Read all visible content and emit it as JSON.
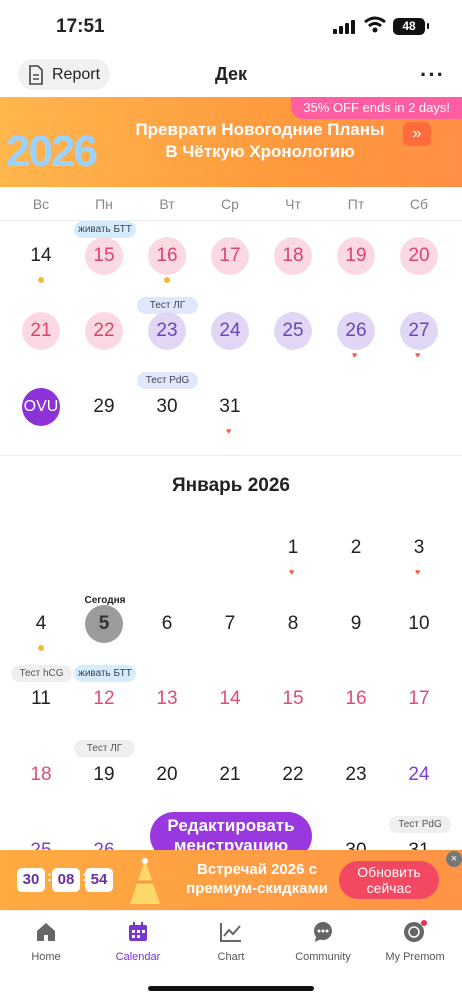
{
  "status_bar": {
    "time": "17:51",
    "battery": "48"
  },
  "header": {
    "report_label": "Report",
    "title": "Дек",
    "more_label": "···"
  },
  "banner": {
    "promo": "35% OFF ends in 2 days!",
    "text": "Превратите Новогодние Планы В Чёткую Хронологию",
    "line1": "Преврати Новогодние Планы",
    "line2": "В Чёткую Хронологию",
    "year": "2026",
    "arrow": "»"
  },
  "weekdays": [
    "Вс",
    "Пн",
    "Вт",
    "Ср",
    "Чт",
    "Пт",
    "Сб"
  ],
  "december": {
    "tags": {
      "row1": "живать БТТ",
      "row2": "Тест ЛГ",
      "row3": "Тест PdG"
    },
    "ovu_label": "OVU",
    "days": [
      "14",
      "15",
      "16",
      "17",
      "18",
      "19",
      "20",
      "21",
      "22",
      "23",
      "24",
      "25",
      "26",
      "27",
      "29",
      "30",
      "31"
    ]
  },
  "january": {
    "title": "Январь 2026",
    "today_label": "Сегодня",
    "tags": {
      "hcg": "Тест hCG",
      "btt": "живать БТТ",
      "lh": "Тест ЛГ",
      "pdg": "Тест PdG"
    },
    "days": [
      "1",
      "2",
      "3",
      "4",
      "5",
      "6",
      "7",
      "8",
      "9",
      "10",
      "11",
      "12",
      "13",
      "14",
      "15",
      "16",
      "17",
      "18",
      "19",
      "20",
      "21",
      "22",
      "23",
      "24",
      "25",
      "26",
      "30",
      "31"
    ]
  },
  "edit_button": {
    "line1": "Редактировать",
    "line2": "менструацию"
  },
  "bottom_banner": {
    "timer": [
      "30",
      "08",
      "54"
    ],
    "line1": "Встречай 2026 с",
    "line2": "премиум-скидками",
    "cta_line1": "Обновить",
    "cta_line2": "сейчас",
    "close": "×"
  },
  "tabs": [
    {
      "label": "Home",
      "icon": "home-icon"
    },
    {
      "label": "Calendar",
      "icon": "calendar-icon"
    },
    {
      "label": "Chart",
      "icon": "chart-icon"
    },
    {
      "label": "Community",
      "icon": "community-icon"
    },
    {
      "label": "My Premom",
      "icon": "profile-icon"
    }
  ],
  "colors": {
    "accent": "#7a35d0",
    "period": "#fbd9e3",
    "fertile": "#e2d6f5",
    "ovulation": "#8b33d6",
    "banner": "#ff9a3d"
  }
}
